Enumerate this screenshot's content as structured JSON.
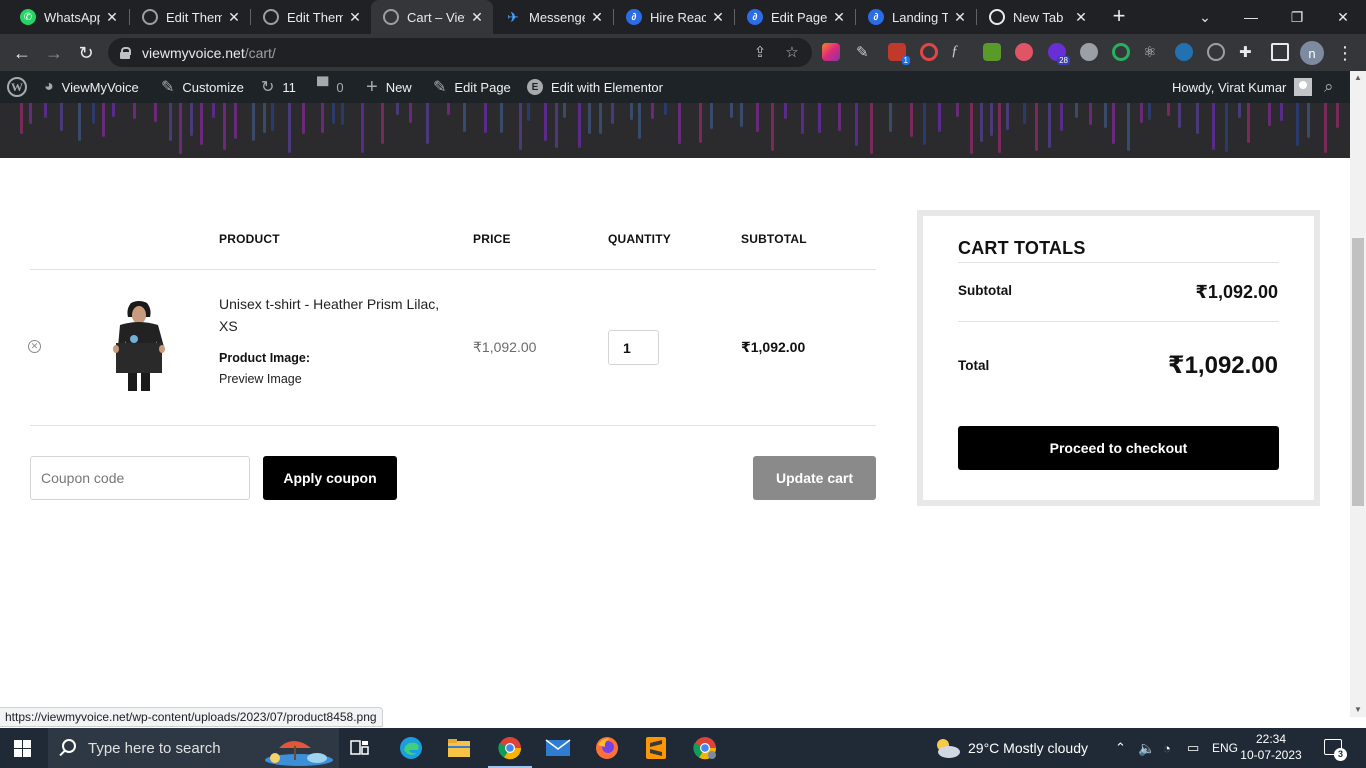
{
  "browser": {
    "tabs": [
      {
        "label": "WhatsApp",
        "favicon": "whatsapp-icon",
        "color": "#25d366"
      },
      {
        "label": "Edit Theme",
        "favicon": "globe-icon",
        "color": "#9aa0a6"
      },
      {
        "label": "Edit Theme",
        "favicon": "globe-icon",
        "color": "#9aa0a6"
      },
      {
        "label": "Cart – View",
        "favicon": "globe-icon",
        "color": "#9aa0a6",
        "active": true
      },
      {
        "label": "Messenger",
        "favicon": "messenger-icon",
        "color": "#4aa7ff"
      },
      {
        "label": "Hire React",
        "favicon": "upwork-like-icon",
        "color": "#2b6de6"
      },
      {
        "label": "Edit Page \"",
        "favicon": "upwork-like-icon",
        "color": "#2b6de6"
      },
      {
        "label": "Landing Te",
        "favicon": "upwork-like-icon",
        "color": "#2b6de6"
      },
      {
        "label": "New Tab",
        "favicon": "chrome-icon",
        "color": "#e8eaed"
      }
    ],
    "close_glyph": "✕",
    "new_tab_glyph": "+",
    "url_host": "viewmyvoice.net",
    "url_path": "/cart/",
    "profile_initial": "n",
    "extension_badges": {
      "red_ext": "1",
      "purple_ext": "28"
    },
    "status_url": "https://viewmyvoice.net/wp-content/uploads/2023/07/product8458.png"
  },
  "adminbar": {
    "site_name": "ViewMyVoice",
    "customize": "Customize",
    "updates_count": "11",
    "comments_count": "0",
    "new_label": "New",
    "edit_page": "Edit Page",
    "elementor": "Edit with Elementor",
    "elementor_glyph": "E",
    "wp_glyph": "W",
    "howdy": "Howdy, Virat Kumar"
  },
  "cart": {
    "headers": {
      "product": "PRODUCT",
      "price": "PRICE",
      "quantity": "QUANTITY",
      "subtotal": "SUBTOTAL"
    },
    "item": {
      "name": "Unisex t-shirt - Heather Prism Lilac, XS",
      "meta_label": "Product Image:",
      "meta_value": "Preview Image",
      "price": "₹1,092.00",
      "quantity": "1",
      "subtotal": "₹1,092.00",
      "remove_glyph": "✕"
    },
    "coupon_placeholder": "Coupon code",
    "apply_coupon": "Apply coupon",
    "update_cart": "Update cart"
  },
  "totals": {
    "title": "CART TOTALS",
    "subtotal_label": "Subtotal",
    "subtotal_value": "₹1,092.00",
    "total_label": "Total",
    "total_value": "₹1,092.00",
    "checkout": "Proceed to checkout"
  },
  "taskbar": {
    "search_placeholder": "Type here to search",
    "weather": "29°C  Mostly cloudy",
    "language": "ENG",
    "time": "22:34",
    "date": "10-07-2023",
    "notification_count": "3"
  },
  "colors": {
    "accent_black": "#000000",
    "update_btn_gray": "#8a8a8a",
    "adminbar_bg": "#1d2327",
    "browser_dark": "#202124"
  }
}
